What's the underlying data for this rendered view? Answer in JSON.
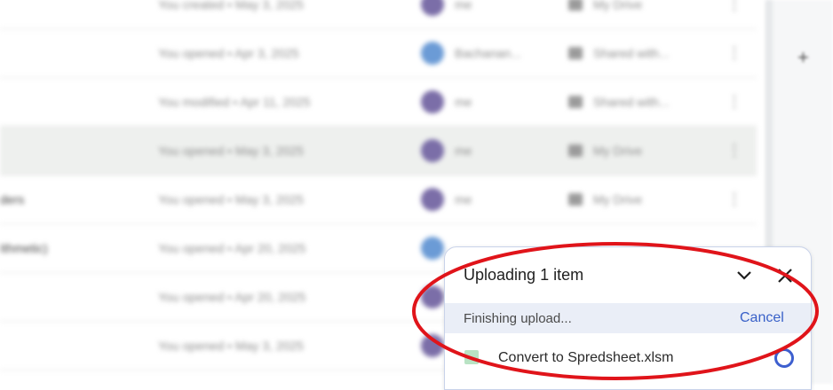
{
  "file_list": {
    "rows": [
      {
        "name": "",
        "date": "You created • May 3, 2025",
        "owner": "me",
        "location": "My Drive"
      },
      {
        "name": "",
        "date": "You opened • Apr 3, 2025",
        "owner": "Bachanan...",
        "location": "Shared with..."
      },
      {
        "name": "",
        "date": "You modified • Apr 11, 2025",
        "owner": "me",
        "location": "Shared with..."
      },
      {
        "name": "",
        "date": "You opened • May 3, 2025",
        "owner": "me",
        "location": "My Drive"
      },
      {
        "name": "ders",
        "date": "You opened • May 3, 2025",
        "owner": "me",
        "location": "My Drive"
      },
      {
        "name": "Ithmetic)",
        "date": "You opened • Apr 20, 2025",
        "owner": "",
        "location": ""
      },
      {
        "name": "",
        "date": "You opened • Apr 20, 2025",
        "owner": "",
        "location": ""
      },
      {
        "name": "",
        "date": "You opened • May 3, 2025",
        "owner": "",
        "location": ""
      }
    ]
  },
  "right_rail": {
    "plus_glyph": "+"
  },
  "upload_panel": {
    "title": "Uploading 1 item",
    "status": "Finishing upload...",
    "cancel_label": "Cancel",
    "file": {
      "name": "Convert to Spredsheet.xlsm",
      "icon": "sheets-file-icon"
    },
    "collapse_icon": "chevron-down-icon",
    "close_icon": "close-icon"
  },
  "colors": {
    "accent": "#3860c8",
    "status_bar": "#eaeef7",
    "annotation": "#e0141a"
  }
}
